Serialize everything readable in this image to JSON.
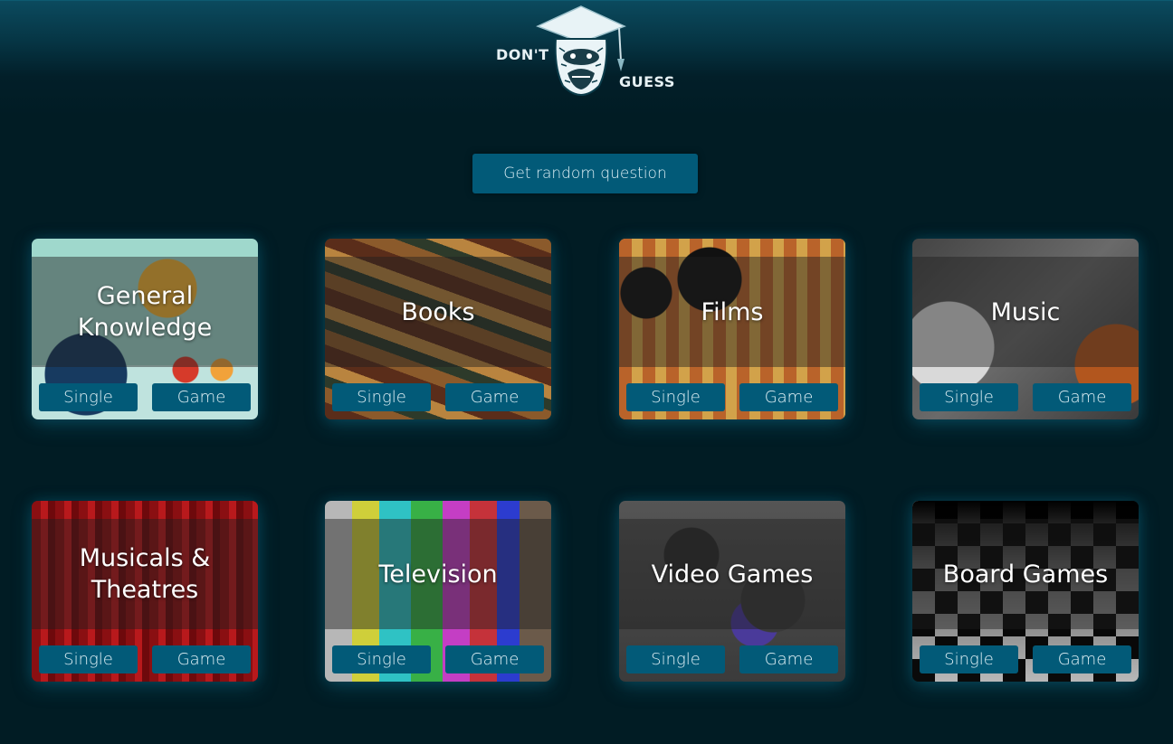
{
  "header": {
    "logo_word_left": "DON'T",
    "logo_word_right": "GUESS"
  },
  "random_button": {
    "label": "Get random question"
  },
  "categories": [
    {
      "title": "General Knowledge",
      "single_label": "Single",
      "game_label": "Game"
    },
    {
      "title": "Books",
      "single_label": "Single",
      "game_label": "Game"
    },
    {
      "title": "Films",
      "single_label": "Single",
      "game_label": "Game"
    },
    {
      "title": "Music",
      "single_label": "Single",
      "game_label": "Game"
    },
    {
      "title": "Musicals & Theatres",
      "single_label": "Single",
      "game_label": "Game"
    },
    {
      "title": "Television",
      "single_label": "Single",
      "game_label": "Game"
    },
    {
      "title": "Video Games",
      "single_label": "Single",
      "game_label": "Game"
    },
    {
      "title": "Board Games",
      "single_label": "Single",
      "game_label": "Game"
    }
  ],
  "colors": {
    "background": "#011c24",
    "button": "#025a78",
    "button_text": "#e2f1f6"
  }
}
